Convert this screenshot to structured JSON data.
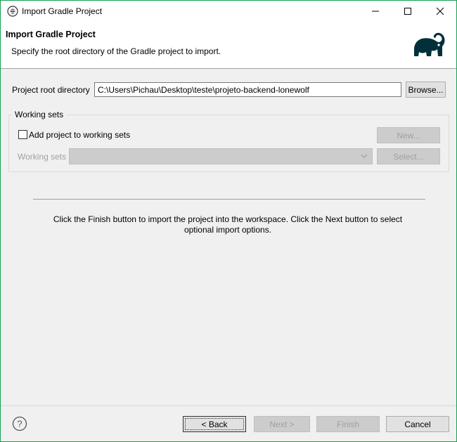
{
  "window": {
    "title": "Import Gradle Project",
    "controls": [
      "minimize-icon",
      "maximize-icon",
      "close-icon"
    ]
  },
  "banner": {
    "title": "Import Gradle Project",
    "subtitle": "Specify the root directory of the Gradle project to import.",
    "logo": "gradle-elephant-logo"
  },
  "project_root": {
    "label": "Project root directory",
    "value": "C:\\Users\\Pichau\\Desktop\\teste\\projeto-backend-lonewolf",
    "browse_label": "Browse..."
  },
  "working_sets": {
    "legend": "Working sets",
    "checkbox_label": "Add project to working sets",
    "checkbox_checked": false,
    "new_label": "New...",
    "sets_label": "Working sets",
    "sets_value": "",
    "select_label": "Select..."
  },
  "info": {
    "message": "Click the Finish button to import the project into the workspace. Click the Next button to select optional import options."
  },
  "footer": {
    "help_icon": "help-icon",
    "back_label": "< Back",
    "next_label": "Next >",
    "finish_label": "Finish",
    "cancel_label": "Cancel"
  },
  "colors": {
    "window_border": "#18a052",
    "logo": "#02303a",
    "dialog_bg": "#f0f0f0"
  }
}
